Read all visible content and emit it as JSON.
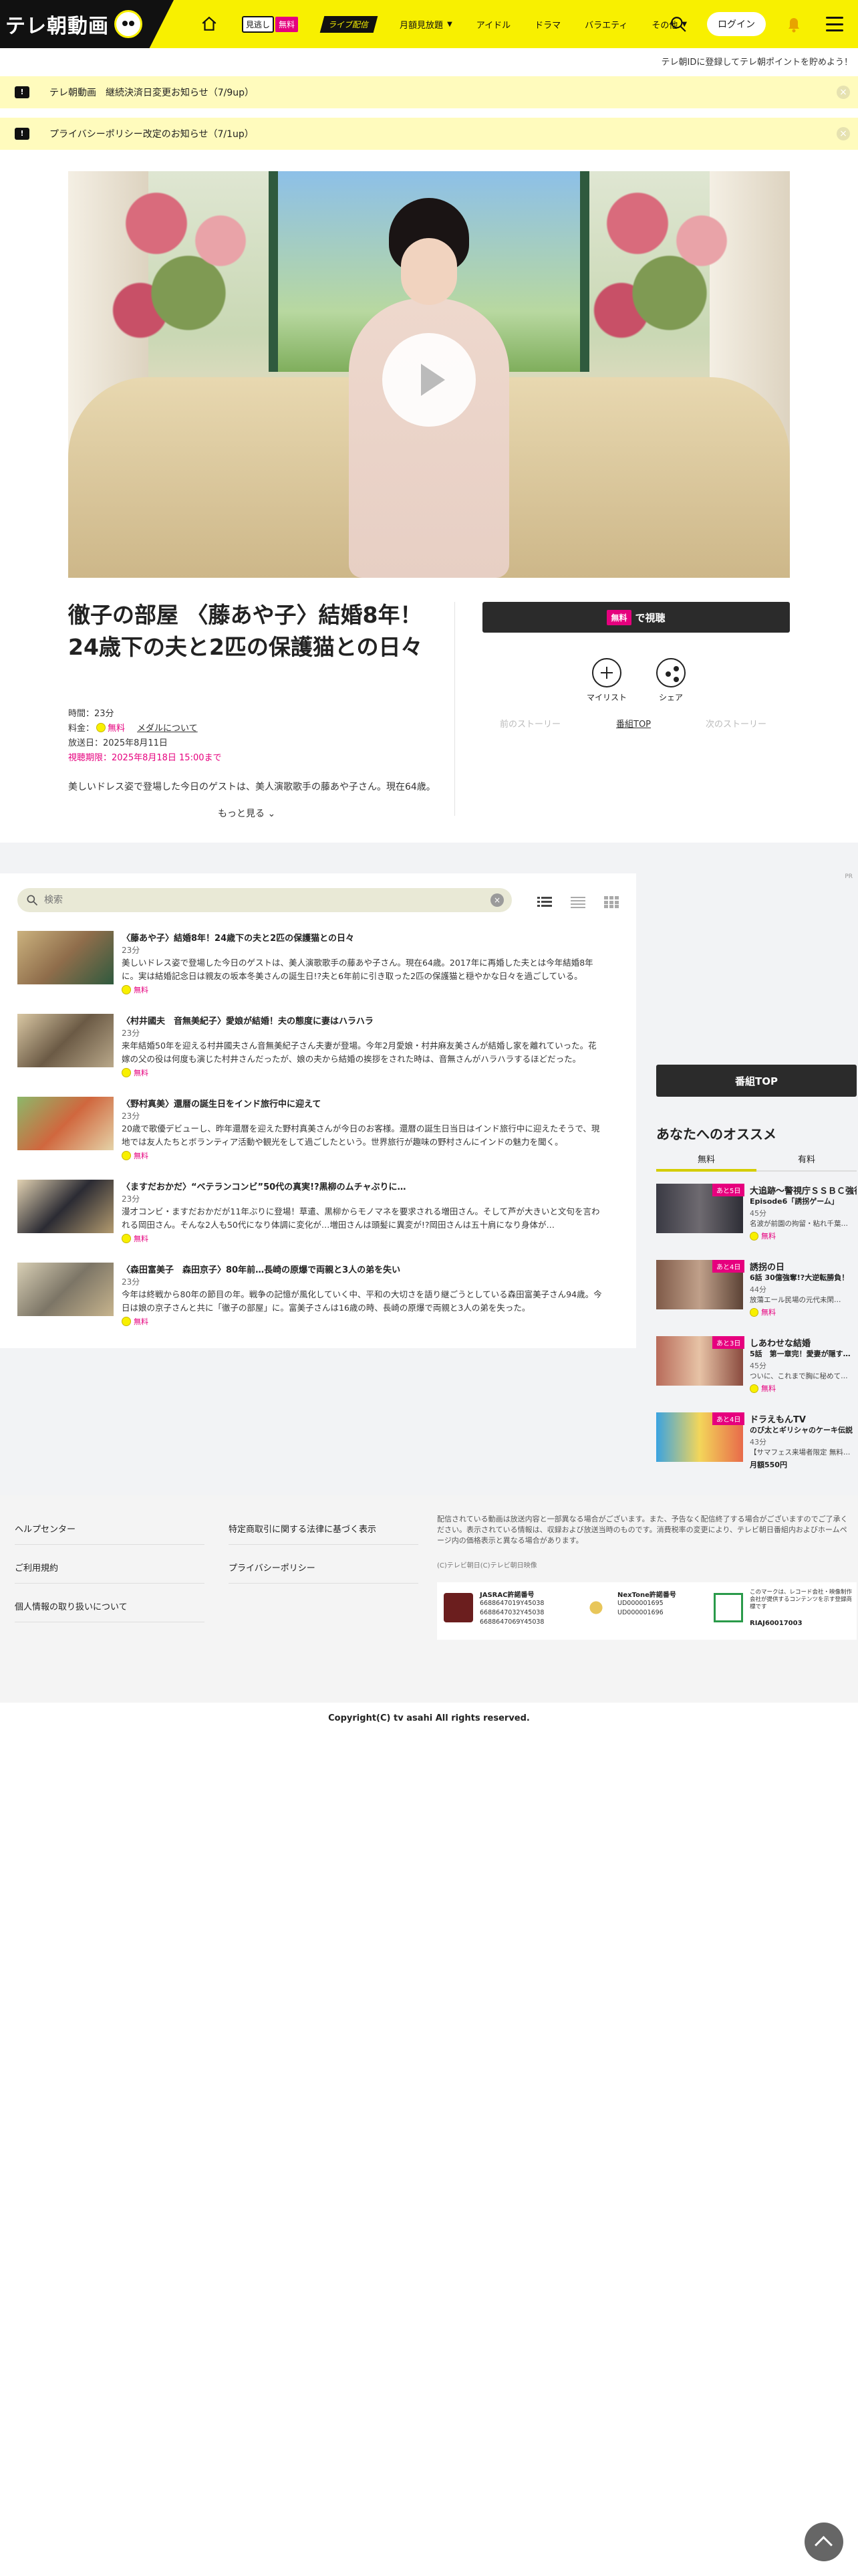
{
  "header": {
    "logo_text": "テレ朝動画",
    "nav": {
      "mitai": "見逃し",
      "free": "無料",
      "live": "ライブ配信",
      "monthly": "月額見放題",
      "idol": "アイドル",
      "drama": "ドラマ",
      "variety": "バラエティ",
      "others": "その他"
    },
    "login": "ログイン"
  },
  "point_message": "テレ朝IDに登録してテレ朝ポイントを貯めよう！",
  "notices": [
    {
      "text": "テレ朝動画　継続決済日変更お知らせ（7/9up）"
    },
    {
      "text": "プライバシーポリシー改定のお知らせ（7/1up）"
    }
  ],
  "program": {
    "title": "徹子の部屋 〈藤あや子〉結婚8年！24歳下の夫と2匹の保護猫との日々",
    "duration": "時間：23分",
    "price_label": "料金：",
    "price_free": "無料",
    "medal_link": "メダルについて",
    "aired": "放送日：2025年8月11日",
    "deadline": "視聴期限：2025年8月18日 15:00まで",
    "description": "美しいドレス姿で登場した今日のゲストは、美人演歌歌手の藤あや子さん。現在64歳。",
    "more": "もっと見る",
    "watch_free": "無料",
    "watch_label": "で視聴",
    "mylist": "マイリスト",
    "share": "シェア",
    "prev_story": "前のストーリー",
    "program_top": "番組TOP",
    "next_story": "次のストーリー"
  },
  "episode_list": {
    "search_placeholder": "検索",
    "pr": "PR",
    "items": [
      {
        "title": "〈藤あや子〉結婚8年！24歳下の夫と2匹の保護猫との日々",
        "duration": "23分",
        "summary": "美しいドレス姿で登場した今日のゲストは、美人演歌歌手の藤あや子さん。現在64歳。2017年に再婚した夫とは今年結婚8年に。実は結婚記念日は親友の坂本冬美さんの誕生日!?夫と6年前に引き取った2匹の保護猫と穏やかな日々を過ごしている。",
        "free": "無料"
      },
      {
        "title": "〈村井國夫　音無美紀子〉愛娘が結婚！夫の態度に妻はハラハラ",
        "duration": "23分",
        "summary": "来年結婚50年を迎える村井國夫さん音無美紀子さん夫妻が登場。今年2月愛娘・村井麻友美さんが結婚し家を離れていった。花嫁の父の役は何度も演じた村井さんだったが、娘の夫から結婚の挨拶をされた時は、音無さんがハラハラするほどだった。",
        "free": "無料"
      },
      {
        "title": "〈野村真美〉還暦の誕生日をインド旅行中に迎えて",
        "duration": "23分",
        "summary": "20歳で歌優デビューし、昨年還暦を迎えた野村真美さんが今日のお客様。還暦の誕生日当日はインド旅行中に迎えたそうで、現地では友人たちとボランティア活動や観光をして過ごしたという。世界旅行が趣味の野村さんにインドの魅力を聞く。",
        "free": "無料"
      },
      {
        "title": "〈ますだおかだ〉“ベテランコンビ”50代の真実!?黒柳のムチャぶりに…",
        "duration": "23分",
        "summary": "漫才コンビ・ますだおかだが11年ぶりに登場！草遣、黒柳からモノマネを要求される増田さん。そして芦が大きいと文句を言われる岡田さん。そんな2人も50代になり体調に変化が…増田さんは頭髪に異変が!?岡田さんは五十肩になり身体が…",
        "free": "無料"
      },
      {
        "title": "〈森田富美子　森田京子〉80年前…長崎の原爆で両親と3人の弟を失い",
        "duration": "23分",
        "summary": "今年は終戦から80年の節目の年。戦争の記憶が風化していく中、平和の大切さを語り継ごうとしている森田富美子さん94歳。今日は娘の京子さんと共に「徹子の部屋」に。富美子さんは16歳の時、長崎の原爆で両親と3人の弟を失った。",
        "free": "無料"
      }
    ]
  },
  "sidebar": {
    "program_top": "番組TOP",
    "recommend_title": "あなたへのオススメ",
    "tab_free": "無料",
    "tab_paid": "有料",
    "items": [
      {
        "badge": "あと5日",
        "title": "大追跡～警視庁ＳＳＢＣ強行犯…",
        "sub": "Episode6「誘拐ゲーム」",
        "duration": "45分",
        "summary": "名波が前園の拘留・粘れ千葉…",
        "free": "無料"
      },
      {
        "badge": "あと4日",
        "title": "誘拐の日",
        "sub": "6話 30億強奪!?大逆転勝負！",
        "duration": "44分",
        "summary": "放蕩エール民場の元代未閑…",
        "free": "無料"
      },
      {
        "badge": "あと3日",
        "title": "しあわせな結婚",
        "sub": "5話　第一章完！愛妻が隠す…",
        "duration": "45分",
        "summary": "ついに、これまで胸に秘めて…",
        "free": "無料"
      },
      {
        "badge": "あと4日",
        "title": "ドラえもんTV",
        "sub": "のび太とギリシャのケーキ伝説",
        "duration": "43分",
        "summary": "【サマフェス来場者限定 無料…",
        "price": "月額550円"
      }
    ]
  },
  "footer": {
    "links": [
      "ヘルプセンター",
      "特定商取引に関する法律に基づく表示",
      "ご利用規約",
      "プライバシーポリシー",
      "個人情報の取り扱いについて"
    ],
    "note": "配信されている動画は放送内容と一部異なる場合がございます。また、予告なく配信終了する場合がございますのでご了承ください。表示されている情報は、収録および放送当時のものです。消費税率の変更により、テレビ朝日番組内およびホームページ内の価格表示と異なる場合があります。",
    "copy_small": "(C)テレビ朝日(C)テレビ朝日映像",
    "jasrac_name": "JASRAC許諾番号",
    "jasrac_codes": [
      "6688647019Y45038",
      "6688647032Y45038",
      "6688647069Y45038"
    ],
    "nextone_name": "NexTone許諾番号",
    "nextone_codes": [
      "UD000001695",
      "UD000001696"
    ],
    "riaj_text": "このマークは、レコード会社・映像制作会社が提供するコンテンツを示す登録商標です",
    "riaj_code": "RIAJ60017003"
  },
  "copyright": "Copyright(C) tv asahi All rights reserved."
}
